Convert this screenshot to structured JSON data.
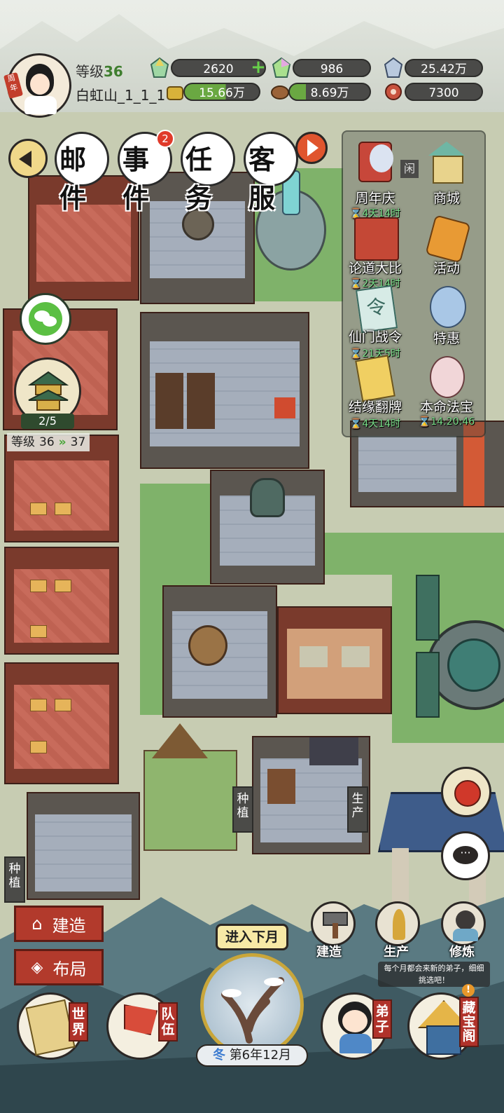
{
  "player": {
    "level_label": "等级",
    "level": "36",
    "name": "白虹山_1_1_1",
    "avatar_badge": "周年"
  },
  "resources": {
    "row1": [
      {
        "icon": "rainbow-crystal-icon",
        "value": "2620",
        "has_add": true
      },
      {
        "icon": "rainbow-gem-icon",
        "value": "986"
      },
      {
        "icon": "spirit-stone-icon",
        "value": "25.42万"
      }
    ],
    "row2": [
      {
        "icon": "gold-ingot-icon",
        "value": "15.66万"
      },
      {
        "icon": "wood-icon",
        "value": "8.69万"
      },
      {
        "icon": "meat-icon",
        "value": "7300"
      }
    ]
  },
  "top_menu": {
    "mail": "邮件",
    "events": "事件",
    "events_badge": "2",
    "tasks": "任务",
    "service": "客服"
  },
  "side_left": {
    "sect_progress": "2/5",
    "level_label": "等级",
    "level_from": "36",
    "level_to": "37"
  },
  "activities": [
    {
      "label": "周年庆",
      "timer": "4天14时",
      "key": "anniversary"
    },
    {
      "label": "商城",
      "timer": "",
      "key": "shop"
    },
    {
      "label": "论道大比",
      "timer": "2天14时",
      "key": "debate"
    },
    {
      "label": "活动",
      "timer": "",
      "key": "events"
    },
    {
      "label": "仙门战令",
      "timer": "21天5时",
      "key": "battle-pass"
    },
    {
      "label": "特惠",
      "timer": "",
      "key": "deals"
    },
    {
      "label": "结缘翻牌",
      "timer": "4天14时",
      "key": "card-flip"
    },
    {
      "label": "本命法宝",
      "timer": "14:20:46",
      "key": "treasure"
    }
  ],
  "map_labels": {
    "plant1": "种植",
    "plant2": "种植",
    "produce": "生产",
    "lock_hint": "闲"
  },
  "bottom": {
    "build": "建造",
    "layout": "布局",
    "next_month": "进入下月",
    "season": "冬",
    "date": "第6年12月",
    "tool_build": "建造",
    "tool_produce": "生产",
    "tool_cultivate": "修炼",
    "tip": "每个月都会来新的弟子，细细挑选吧！",
    "world": "世界",
    "team": "队伍",
    "disciple": "弟子",
    "library": "藏宝阁"
  },
  "colors": {
    "accent_green": "#7be08a",
    "panel_dark": "#4a4a48",
    "red": "#b23a2c",
    "gold": "#e6b45a"
  }
}
